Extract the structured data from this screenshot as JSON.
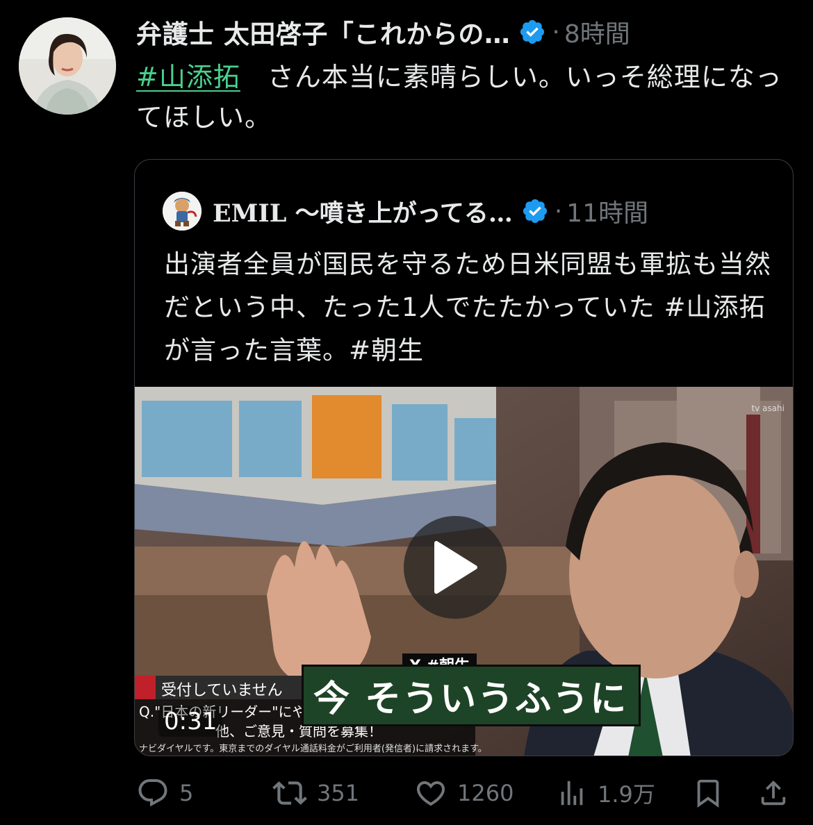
{
  "post": {
    "author_name": "弁護士 太田啓子「これからの…",
    "separator": "·",
    "time": "8時間",
    "hashtag": "#山添拓",
    "text_after_hashtag": "　さん本当に素晴らしい。いっそ総理になってほしい。"
  },
  "quoted_post": {
    "author_name": "EMIL 〜噴き上がってる…",
    "separator": "·",
    "time": "11時間",
    "text": "出演者全員が国民を守るため日米同盟も軍拡も当然だという中、たった1人でたたかっていた #山添拓 が言った言葉。#朝生",
    "video": {
      "duration": "0:31",
      "caption": "今 そういうふうに",
      "caption_tag": "X #朝生",
      "ticker_line1": "受付していません",
      "ticker_line2": "Q.\"日本の新リーダー\"にやってほしい",
      "ticker_line3": "他、ご意見・質問を募集！",
      "ticker_line4": "ナビダイヤルです。東京までのダイヤル通話料金がご利用者(発信者)に請求されます。",
      "channel_logo": "tv asahi"
    }
  },
  "actions": {
    "reply_count": "5",
    "retweet_count": "351",
    "like_count": "1260",
    "view_count": "1.9万"
  },
  "colors": {
    "background": "#000000",
    "text": "#e7e9ea",
    "muted": "#71767b",
    "hashtag": "#4ad08e",
    "verified": "#1d9bf0",
    "border": "#3a3f44"
  }
}
